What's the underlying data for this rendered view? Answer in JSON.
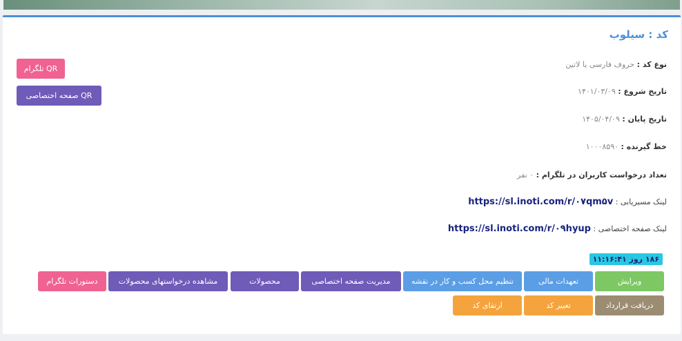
{
  "header": {
    "title": "کد : سیلوب"
  },
  "details": {
    "code_type_label": "نوع کد :",
    "code_type_value": "حروف فارسی یا لاتین",
    "start_label": "تاریخ شروع :",
    "start_value": "۱۴۰۱/۰۳/۰۹",
    "end_label": "تاریخ پایان :",
    "end_value": "۱۴۰۵/۰۴/۰۹",
    "line_label": "خط گیرنده :",
    "line_value": "۱۰۰۰۸۵۹۰",
    "tg_requests_label": "تعداد درخواست کاربران در تلگرام :",
    "tg_requests_value": "۰ نفر",
    "route_link_label": "لینک مسیریابی :",
    "route_link_value": "https://sl.inoti.com/r/۰۷qm۵v",
    "page_link_label": "لینک صفحه اختصاصی :",
    "page_link_value": "https://sl.inoti.com/r/۰۹hyup"
  },
  "qr": {
    "telegram": "QR تلگرام",
    "private_page": "QR صفحه اختصاصی"
  },
  "timer": "۱۸۶ روز ۱۱:۱۶:۴۱",
  "actions": {
    "edit": "ویرایش",
    "financial": "تعهدات مالی",
    "map": "تنظیم محل کسب و کار در نقشه",
    "page_manage": "مدیریت صفحه اختصاصی",
    "products": "محصولات",
    "product_requests": "مشاهده درخواستهای محصولات",
    "tg_commands": "دستورات تلگرام",
    "contract": "دریافت قرارداد",
    "change_code": "تغییر کد",
    "upgrade_code": "ارتقای کد"
  },
  "colors": {
    "accent": "#4a90d9",
    "green": "#7dc862",
    "blue": "#5b9ee6",
    "purple": "#6f5bb8",
    "pink": "#f06292",
    "orange": "#f5a33c",
    "khaki": "#9c8c72",
    "cyan": "#29c7e0"
  }
}
